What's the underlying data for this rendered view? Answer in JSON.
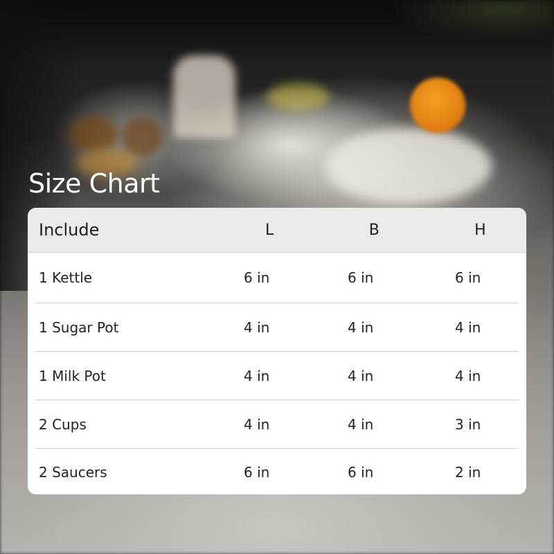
{
  "title": "Size Chart",
  "table": {
    "headers": [
      "Include",
      "L",
      "B",
      "H"
    ],
    "rows": [
      {
        "item": "1 Kettle",
        "l": "6 in",
        "b": "6 in",
        "h": "6 in"
      },
      {
        "item": "1 Sugar Pot",
        "l": "4 in",
        "b": "4 in",
        "h": "4 in"
      },
      {
        "item": "1 Milk Pot",
        "l": "4 in",
        "b": "4 in",
        "h": "4 in"
      },
      {
        "item": "2 Cups",
        "l": "4 in",
        "b": "4 in",
        "h": "3 in"
      },
      {
        "item": "2 Saucers",
        "l": "6 in",
        "b": "6 in",
        "h": "2 in"
      }
    ]
  },
  "colors": {
    "header_bg": "#edebe7",
    "card_bg": "#ffffff",
    "title_text": "#ffffff",
    "body_text": "#222222"
  }
}
